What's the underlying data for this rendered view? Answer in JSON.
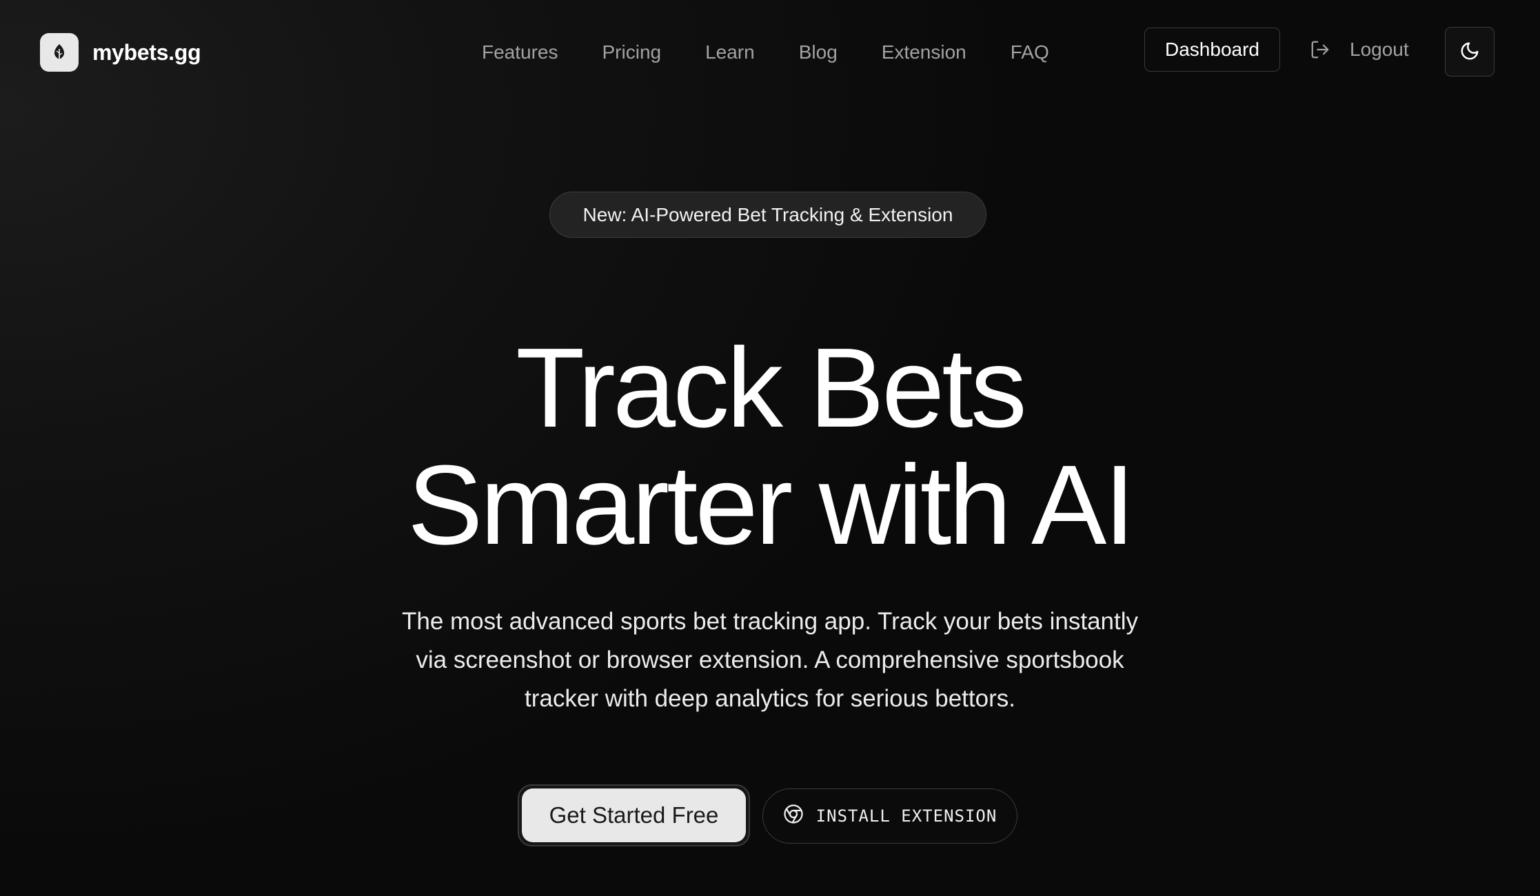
{
  "brand": {
    "name": "mybets.gg",
    "logo_icon": "leaf-logo-icon"
  },
  "nav": {
    "items": [
      {
        "label": "Features"
      },
      {
        "label": "Pricing"
      },
      {
        "label": "Learn"
      },
      {
        "label": "Blog"
      },
      {
        "label": "Extension"
      },
      {
        "label": "FAQ"
      }
    ]
  },
  "header": {
    "dashboard_label": "Dashboard",
    "logout_label": "Logout",
    "logout_icon": "logout-icon",
    "theme_icon": "moon-icon"
  },
  "hero": {
    "badge": "New: AI-Powered Bet Tracking & Extension",
    "headline_line1": "Track Bets",
    "headline_line2": "Smarter with AI",
    "subtext": "The most advanced sports bet tracking app. Track your bets instantly via screenshot or browser extension. A comprehensive sportsbook tracker with deep analytics for serious bettors.",
    "cta_primary": "Get Started Free",
    "cta_secondary": "INSTALL EXTENSION",
    "cta_secondary_icon": "chrome-icon"
  },
  "colors": {
    "background": "#0a0a0a",
    "text_primary": "#ffffff",
    "text_muted": "#a3a3a3",
    "border": "#3a3a3a",
    "button_light": "#e8e8e8"
  }
}
